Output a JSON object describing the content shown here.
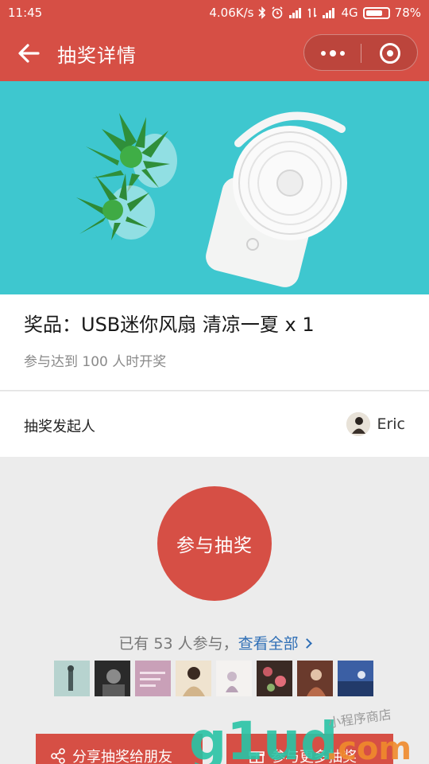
{
  "status_bar": {
    "time": "11:45",
    "speed": "4.06K/s",
    "network": "4G",
    "battery": "78%",
    "battery_level": 0.78
  },
  "header": {
    "title": "抽奖详情",
    "back_icon": "arrow-left-icon",
    "more_icon": "more-dots-icon",
    "close_icon": "target-circle-icon"
  },
  "prize": {
    "name": "奖品：USB迷你风扇 清凉一夏 x 1",
    "rule": "参与达到 100 人时开奖"
  },
  "creator": {
    "label": "抽奖发起人",
    "name": "Eric"
  },
  "join": {
    "label": "参与抽奖"
  },
  "participants": {
    "text": "已有 53 人参与，",
    "link": "查看全部"
  },
  "actions": {
    "share": "分享抽奖给朋友",
    "more": "参与更多抽奖"
  },
  "watermark": {
    "brand": "g1ud.com",
    "sub": "小程序商店"
  },
  "colors": {
    "accent": "#d64f45",
    "link": "#2f6fb6",
    "hero_bg": "#3ec7cf"
  }
}
